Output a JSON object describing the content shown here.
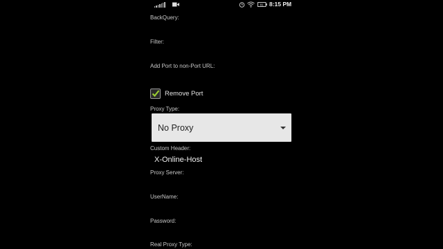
{
  "status_bar": {
    "time": "8:15 PM",
    "battery": "81"
  },
  "settings": {
    "back_query_label": "BackQuery:",
    "filter_label": "Filter:",
    "add_port_label": "Add Port to non-Port URL:",
    "remove_port": {
      "label": "Remove Port",
      "checked": true
    },
    "proxy_type_label": "Proxy Type:",
    "proxy_type_value": "No Proxy",
    "custom_header_label": "Custom Header:",
    "custom_header_value": "X-Online-Host",
    "proxy_server_label": "Proxy Server:",
    "username_label": "UserName:",
    "password_label": "Password:",
    "real_proxy_type_label": "Real Proxy Type:"
  },
  "colors": {
    "background": "#000000",
    "checkmark": "#9acd32",
    "dropdown_bg": "#e7e7e7"
  }
}
